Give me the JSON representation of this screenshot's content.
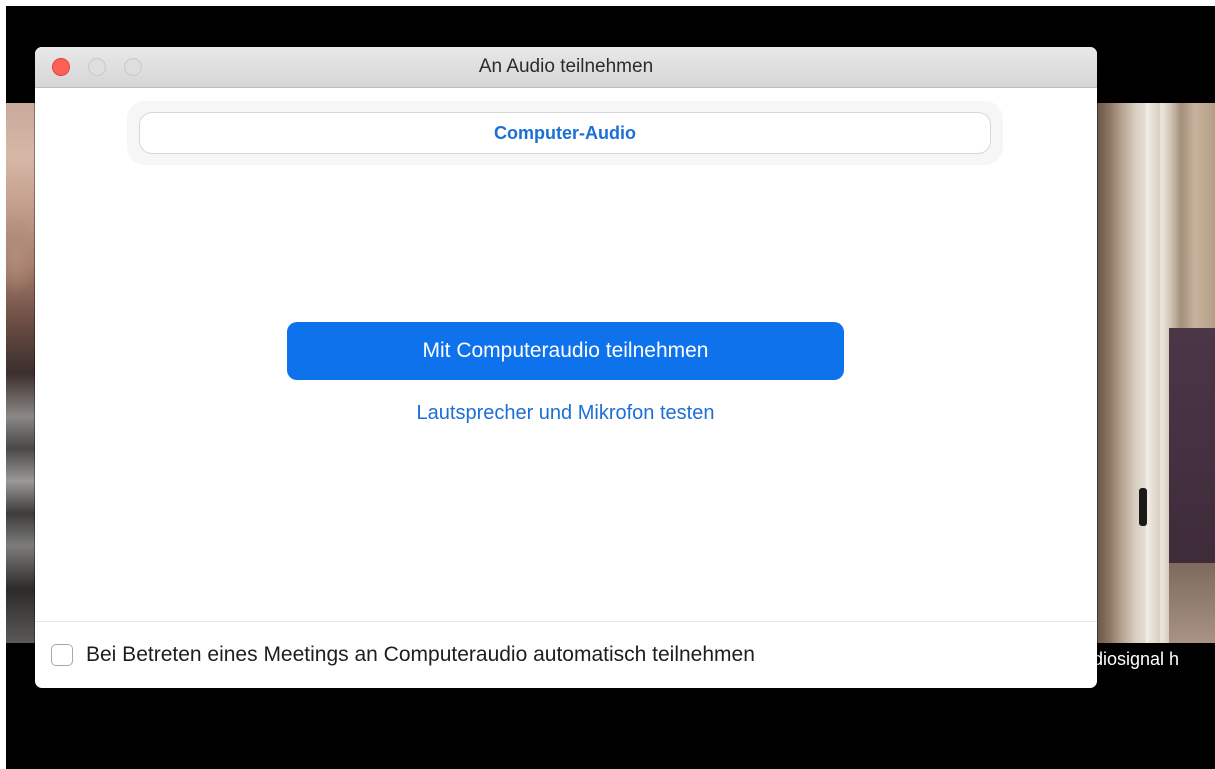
{
  "window": {
    "title": "An Audio teilnehmen"
  },
  "tabs": [
    {
      "label": "Computer-Audio",
      "active": true
    }
  ],
  "main": {
    "join_button_label": "Mit Computeraudio teilnehmen",
    "test_link_label": "Lautsprecher und Mikrofon testen"
  },
  "footer": {
    "auto_join_checkbox_label": "Bei Betreten eines Meetings an Computeraudio automatisch teilnehmen",
    "auto_join_checked": false
  },
  "background": {
    "video_caption_fragment": "diosignal h"
  },
  "colors": {
    "accent": "#0e72ed",
    "link": "#1b6fd6",
    "close_button": "#fe5f57"
  },
  "icons": {
    "close": "close-icon",
    "minimize": "minimize-icon",
    "maximize": "maximize-icon"
  }
}
